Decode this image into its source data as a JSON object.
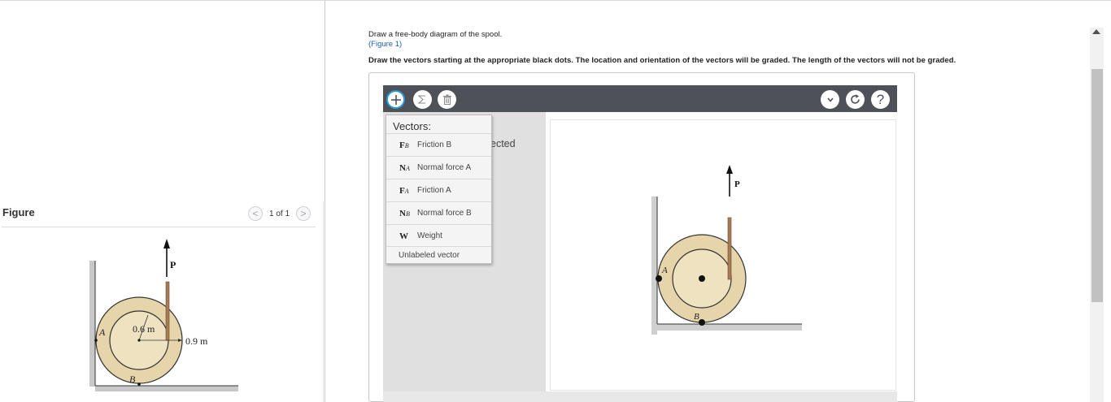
{
  "figure_panel": {
    "header": "Figure",
    "nav": {
      "prev": "<",
      "count": "1 of 1",
      "next": ">"
    },
    "diagram_labels": {
      "force": "P",
      "left_point": "A",
      "bottom_point": "B",
      "inner_radius": "0.6 m",
      "outer_radius": "0.9 m"
    }
  },
  "question": {
    "prompt": "Draw a free-body diagram of the spool.",
    "figure_link": "(Figure 1)",
    "instructions": "Draw the vectors starting at the appropriate black dots. The location and orientation of the vectors will be graded. The length of the vectors will not be graded."
  },
  "toolbar": {
    "add_icon": "plus-icon",
    "sum_icon": "sigma-icon",
    "delete_icon": "trash-icon",
    "chevron_icon": "chevron-down-icon",
    "reset_icon": "reset-icon",
    "help_label": "?"
  },
  "side_panel": {
    "selected_fragment": "ected"
  },
  "vector_menu": {
    "title": "Vectors:",
    "items": [
      {
        "symbol": "F",
        "subscript": "B",
        "label": "Friction B"
      },
      {
        "symbol": "N",
        "subscript": "A",
        "label": "Normal force A"
      },
      {
        "symbol": "F",
        "subscript": "A",
        "label": "Friction A"
      },
      {
        "symbol": "N",
        "subscript": "B",
        "label": "Normal force B"
      },
      {
        "symbol": "W",
        "subscript": "",
        "label": "Weight"
      }
    ],
    "unlabeled": "Unlabeled vector"
  },
  "canvas_labels": {
    "force": "P",
    "left_point": "A",
    "bottom_point": "B"
  },
  "colors": {
    "toolbar_bg": "#4f5159",
    "spool_fill": "#e6d5aa",
    "accent_blue": "#2a9bd6",
    "link": "#1a62b8"
  }
}
